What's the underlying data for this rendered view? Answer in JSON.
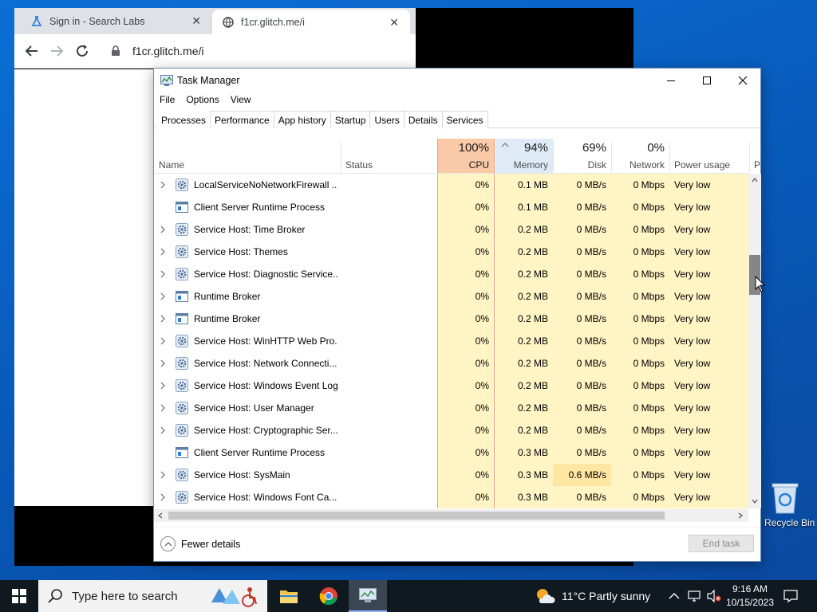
{
  "browser": {
    "tabs": [
      {
        "title": "Sign in - Search Labs",
        "icon": "flask-icon"
      },
      {
        "title": "f1cr.glitch.me/i",
        "icon": "globe-icon"
      }
    ],
    "address": "f1cr.glitch.me/i"
  },
  "taskmanager": {
    "title": "Task Manager",
    "menu": [
      "File",
      "Options",
      "View"
    ],
    "tabs": [
      "Processes",
      "Performance",
      "App history",
      "Startup",
      "Users",
      "Details",
      "Services"
    ],
    "active_tab": "Processes",
    "columns": {
      "name": "Name",
      "status": "Status",
      "cpu": {
        "pct": "100%",
        "label": "CPU"
      },
      "memory": {
        "pct": "94%",
        "label": "Memory"
      },
      "disk": {
        "pct": "69%",
        "label": "Disk"
      },
      "network": {
        "pct": "0%",
        "label": "Network"
      },
      "power": "Power usage",
      "power_trend": "P"
    },
    "rows": [
      {
        "name": "LocalServiceNoNetworkFirewall ...",
        "expand": true,
        "icon": "gear-icon",
        "cpu": "0%",
        "memory": "0.1 MB",
        "disk": "0 MB/s",
        "network": "0 Mbps",
        "power": "Very low"
      },
      {
        "name": "Client Server Runtime Process",
        "expand": false,
        "icon": "window-icon",
        "cpu": "0%",
        "memory": "0.1 MB",
        "disk": "0 MB/s",
        "network": "0 Mbps",
        "power": "Very low"
      },
      {
        "name": "Service Host: Time Broker",
        "expand": true,
        "icon": "gear-icon",
        "cpu": "0%",
        "memory": "0.2 MB",
        "disk": "0 MB/s",
        "network": "0 Mbps",
        "power": "Very low"
      },
      {
        "name": "Service Host: Themes",
        "expand": true,
        "icon": "gear-icon",
        "cpu": "0%",
        "memory": "0.2 MB",
        "disk": "0 MB/s",
        "network": "0 Mbps",
        "power": "Very low"
      },
      {
        "name": "Service Host: Diagnostic Service...",
        "expand": true,
        "icon": "gear-icon",
        "cpu": "0%",
        "memory": "0.2 MB",
        "disk": "0 MB/s",
        "network": "0 Mbps",
        "power": "Very low"
      },
      {
        "name": "Runtime Broker",
        "expand": true,
        "icon": "window-icon",
        "cpu": "0%",
        "memory": "0.2 MB",
        "disk": "0 MB/s",
        "network": "0 Mbps",
        "power": "Very low"
      },
      {
        "name": "Runtime Broker",
        "expand": true,
        "icon": "window-icon",
        "cpu": "0%",
        "memory": "0.2 MB",
        "disk": "0 MB/s",
        "network": "0 Mbps",
        "power": "Very low"
      },
      {
        "name": "Service Host: WinHTTP Web Pro...",
        "expand": true,
        "icon": "gear-icon",
        "cpu": "0%",
        "memory": "0.2 MB",
        "disk": "0 MB/s",
        "network": "0 Mbps",
        "power": "Very low"
      },
      {
        "name": "Service Host: Network Connecti...",
        "expand": true,
        "icon": "gear-icon",
        "cpu": "0%",
        "memory": "0.2 MB",
        "disk": "0 MB/s",
        "network": "0 Mbps",
        "power": "Very low"
      },
      {
        "name": "Service Host: Windows Event Log",
        "expand": true,
        "icon": "gear-icon",
        "cpu": "0%",
        "memory": "0.2 MB",
        "disk": "0 MB/s",
        "network": "0 Mbps",
        "power": "Very low"
      },
      {
        "name": "Service Host: User Manager",
        "expand": true,
        "icon": "gear-icon",
        "cpu": "0%",
        "memory": "0.2 MB",
        "disk": "0 MB/s",
        "network": "0 Mbps",
        "power": "Very low"
      },
      {
        "name": "Service Host: Cryptographic Ser...",
        "expand": true,
        "icon": "gear-icon",
        "cpu": "0%",
        "memory": "0.2 MB",
        "disk": "0 MB/s",
        "network": "0 Mbps",
        "power": "Very low"
      },
      {
        "name": "Client Server Runtime Process",
        "expand": false,
        "icon": "window-icon",
        "cpu": "0%",
        "memory": "0.3 MB",
        "disk": "0 MB/s",
        "network": "0 Mbps",
        "power": "Very low"
      },
      {
        "name": "Service Host: SysMain",
        "expand": true,
        "icon": "gear-icon",
        "cpu": "0%",
        "memory": "0.3 MB",
        "disk": "0.6 MB/s",
        "network": "0 Mbps",
        "power": "Very low",
        "disk_hot": true
      },
      {
        "name": "Service Host: Windows Font Ca...",
        "expand": true,
        "icon": "gear-icon",
        "cpu": "0%",
        "memory": "0.3 MB",
        "disk": "0 MB/s",
        "network": "0 Mbps",
        "power": "Very low"
      }
    ],
    "fewer_details": "Fewer details",
    "end_task": "End task"
  },
  "desktop": {
    "recycle_bin": "Recycle Bin"
  },
  "taskbar": {
    "search_placeholder": "Type here to search",
    "weather": "11°C  Partly sunny",
    "time": "9:16 AM",
    "date": "10/15/2023"
  },
  "colors": {
    "cpu_header": "#f9c9a8",
    "cpu_cell": "#fff4c4",
    "cell_yellow": "#fff4c4",
    "disk_hot": "#ffe7a3",
    "accent": "#0a63c4"
  }
}
